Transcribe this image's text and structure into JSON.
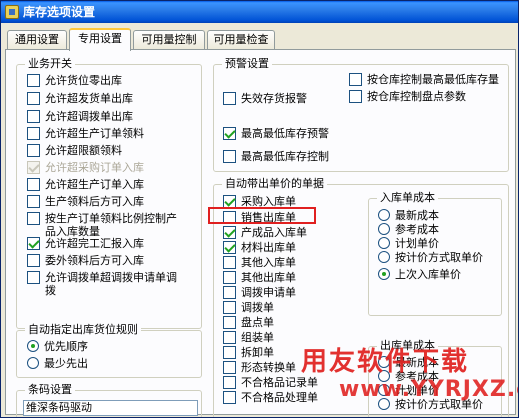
{
  "window": {
    "title": "库存选项设置"
  },
  "tabs": [
    {
      "label": "通用设置"
    },
    {
      "label": "专用设置"
    },
    {
      "label": "可用量控制"
    },
    {
      "label": "可用量检查"
    }
  ],
  "business_switch": {
    "title": "业务开关",
    "items": [
      {
        "label": "允许货位零出库",
        "checked": false,
        "disabled": false
      },
      {
        "label": "允许超发货单出库",
        "checked": false,
        "disabled": false
      },
      {
        "label": "允许超调拨单出库",
        "checked": false,
        "disabled": false
      },
      {
        "label": "允许超生产订单领料",
        "checked": false,
        "disabled": false
      },
      {
        "label": "允许超限额领料",
        "checked": false,
        "disabled": false
      },
      {
        "label": "允许超采购订单入库",
        "checked": true,
        "disabled": true
      },
      {
        "label": "允许超生产订单入库",
        "checked": false,
        "disabled": false
      },
      {
        "label": "生产领料后方可入库",
        "checked": false,
        "disabled": false
      },
      {
        "label": "按生产订单领料比例控制产品入库数量",
        "checked": false,
        "disabled": false
      },
      {
        "label": "允许超完工汇报入库",
        "checked": true,
        "disabled": false
      },
      {
        "label": "委外领料后方可入库",
        "checked": false,
        "disabled": false
      },
      {
        "label": "允许调拨单超调拨申请单调拨",
        "checked": false,
        "disabled": false
      }
    ]
  },
  "auto_location": {
    "title": "自动指定出库货位规则",
    "options": [
      {
        "label": "优先顺序",
        "selected": true
      },
      {
        "label": "最少先出",
        "selected": false
      }
    ]
  },
  "barcode": {
    "title": "条码设置",
    "value": "维深条码驱动"
  },
  "warning": {
    "title": "预警设置",
    "items": [
      {
        "label": "失效存货报警",
        "checked": false
      },
      {
        "label": "按仓库控制最高最低库存量",
        "checked": false
      },
      {
        "label": "按仓库控制盘点参数",
        "checked": false
      },
      {
        "label": "最高最低库存预警",
        "checked": true
      },
      {
        "label": "最高最低库存控制",
        "checked": false
      }
    ]
  },
  "auto_price": {
    "title": "自动带出单价的单据",
    "items": [
      {
        "label": "采购入库单",
        "checked": true
      },
      {
        "label": "销售出库单",
        "checked": false
      },
      {
        "label": "产成品入库单",
        "checked": true
      },
      {
        "label": "材料出库单",
        "checked": true
      },
      {
        "label": "其他入库单",
        "checked": false
      },
      {
        "label": "其他出库单",
        "checked": false
      },
      {
        "label": "调拨申请单",
        "checked": false
      },
      {
        "label": "调拨单",
        "checked": false
      },
      {
        "label": "盘点单",
        "checked": false
      },
      {
        "label": "组装单",
        "checked": false
      },
      {
        "label": "拆卸单",
        "checked": false
      },
      {
        "label": "形态转换单",
        "checked": false
      },
      {
        "label": "不合格品记录单",
        "checked": false
      },
      {
        "label": "不合格品处理单",
        "checked": false
      }
    ]
  },
  "in_cost": {
    "title": "入库单成本",
    "options": [
      {
        "label": "最新成本",
        "selected": false
      },
      {
        "label": "参考成本",
        "selected": false
      },
      {
        "label": "计划单价",
        "selected": false
      },
      {
        "label": "按计价方式取单价",
        "selected": false
      },
      {
        "label": "上次入库单价",
        "selected": true
      }
    ]
  },
  "out_cost": {
    "title": "出库单成本",
    "options": [
      {
        "label": "最新成本",
        "selected": false
      },
      {
        "label": "参考成本",
        "selected": false
      },
      {
        "label": "计划单价",
        "selected": false
      },
      {
        "label": "按计价方式取单价",
        "selected": false
      }
    ]
  },
  "watermark": {
    "line1": "用友软件下载",
    "line2": "www.YYRJXZ.com"
  }
}
